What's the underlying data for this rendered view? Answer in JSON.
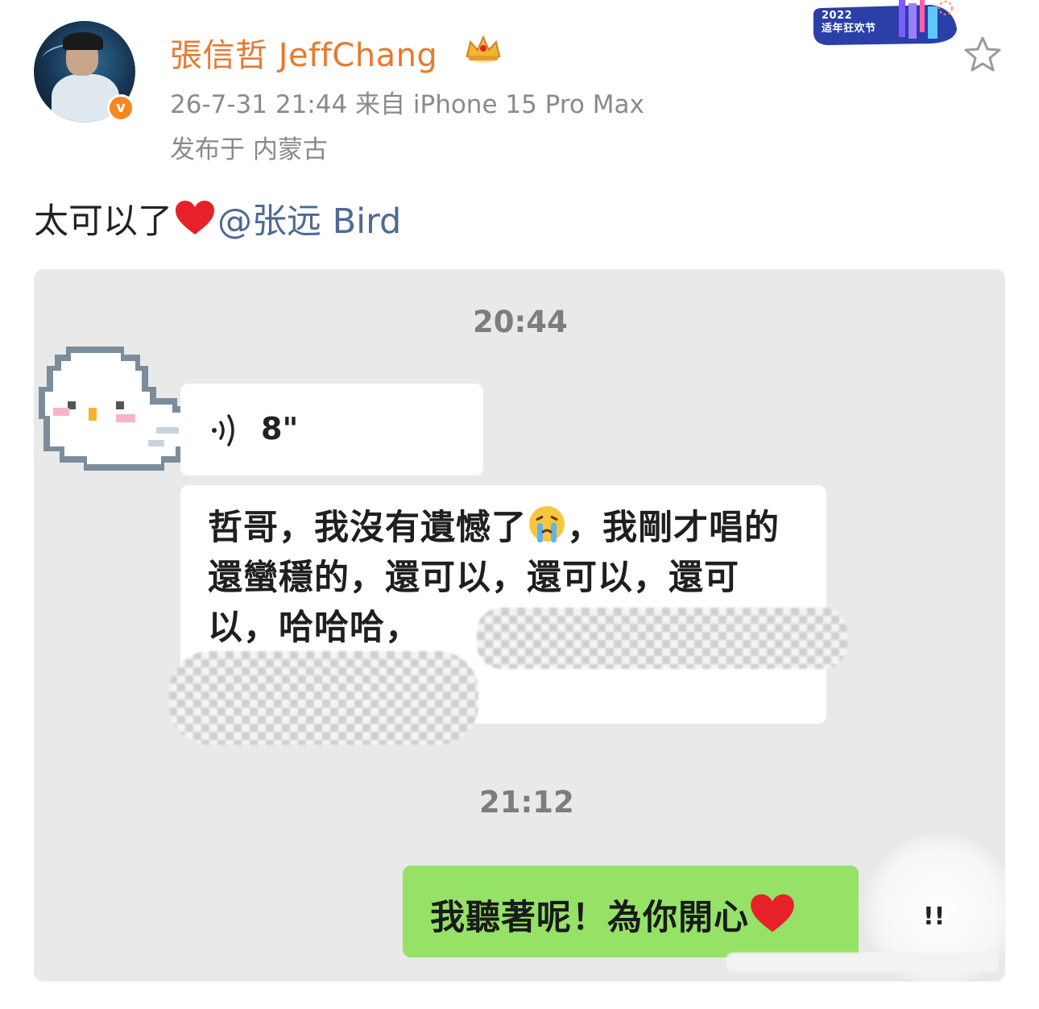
{
  "author": {
    "name": "張信哲 JeffChang",
    "verified_badge": "v",
    "avatar_icon": "avatar-photo",
    "crown_icon": "crown-icon"
  },
  "post_meta": {
    "time_source": "26-7-31 21:44  来自 iPhone 15 Pro Max",
    "location": "发布于 内蒙古"
  },
  "festival_badge": {
    "text_line1": "2022",
    "text_line2": "适年狂欢节"
  },
  "post": {
    "text": "太可以了",
    "mention": "@张远 Bird"
  },
  "chat": {
    "time1": "20:44",
    "voice_duration": "8\"",
    "incoming_message": {
      "part1": "哲哥，我沒有遺憾了",
      "part2": "，我剛才唱的還蠻穩的，還可以，還可以，還可以，哈哈哈，"
    },
    "time2": "21:12",
    "outgoing_message": "我聽著呢！為你開心",
    "trailing_mark": "!!"
  },
  "colors": {
    "username": "#e8792e",
    "meta": "#8a8a8a",
    "mention": "#4d6a94",
    "chat_bg": "#e9e9e9",
    "outgoing_bubble": "#95e267",
    "heart": "#e8202a"
  }
}
